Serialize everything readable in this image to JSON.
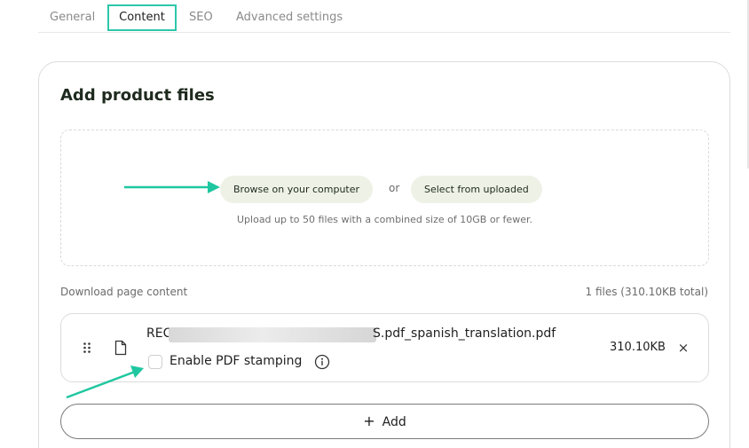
{
  "tabs": [
    {
      "label": "General"
    },
    {
      "label": "Content"
    },
    {
      "label": "SEO"
    },
    {
      "label": "Advanced settings"
    }
  ],
  "card": {
    "title": "Add product files",
    "browse_label": "Browse on your computer",
    "or_text": "or",
    "select_label": "Select from uploaded",
    "upload_hint": "Upload up to 50 files with a combined size of 10GB or fewer."
  },
  "download": {
    "label": "Download page content",
    "total": "1 files (310.10KB total)"
  },
  "file": {
    "name_prefix": "REC",
    "name_suffix": "S.pdf_spanish_translation.pdf",
    "stamping_label": "Enable PDF stamping",
    "size": "310.10KB",
    "remove_glyph": "×"
  },
  "add_label": "Add",
  "colors": {
    "accent": "#2cc7a8",
    "pill_bg": "#eef2e6"
  },
  "icons": {
    "drag": "drag-handle-icon",
    "file": "file-icon",
    "info": "info-icon",
    "plus": "plus-icon",
    "close": "close-icon",
    "annotation": "arrow-icon"
  }
}
